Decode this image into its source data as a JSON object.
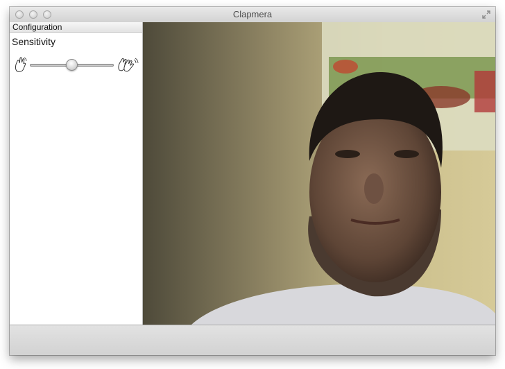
{
  "window": {
    "title": "Clapmera"
  },
  "sidebar": {
    "header": "Configuration",
    "sensitivity_label": "Sensitivity",
    "sensitivity_value": 0.5,
    "left_icon": "single-hand-icon",
    "right_icon": "clapping-hands-icon"
  },
  "camera": {
    "content": "webcam-feed"
  }
}
